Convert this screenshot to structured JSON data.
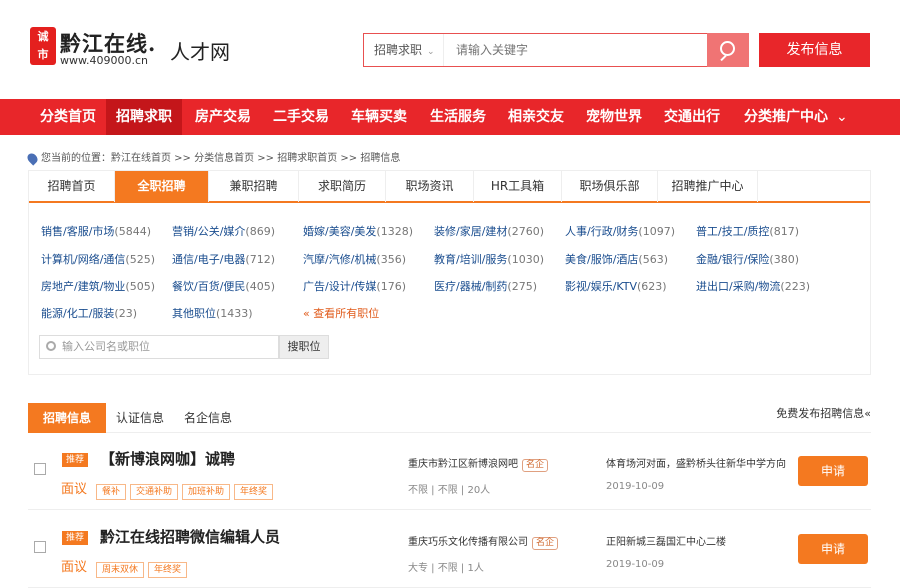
{
  "header": {
    "logo_mark": "诚\n市",
    "logo_name": "黔江在线.",
    "logo_url": "www.409000.cn",
    "logo_sub": "人才网",
    "search_type": "招聘求职",
    "search_placeholder": "请输入关键字",
    "post_button": "发布信息"
  },
  "nav": {
    "items": [
      "分类首页",
      "招聘求职",
      "房产交易",
      "二手交易",
      "车辆买卖",
      "生活服务",
      "相亲交友",
      "宠物世界",
      "交通出行",
      "分类推广中心"
    ],
    "active_index": 1,
    "more_icon": "chevron-down-icon"
  },
  "breadcrumb": "您当前的位置：黔江在线首页 >> 分类信息首页 >> 招聘求职首页 >> 招聘信息",
  "tabs": {
    "items": [
      "招聘首页",
      "全职招聘",
      "兼职招聘",
      "求职简历",
      "职场资讯",
      "HR工具箱",
      "职场俱乐部",
      "招聘推广中心"
    ],
    "active_index": 1
  },
  "categories": [
    {
      "name": "销售/客服/市场",
      "count": "(5844)"
    },
    {
      "name": "营销/公关/媒介",
      "count": "(869)"
    },
    {
      "name": "婚嫁/美容/美发",
      "count": "(1328)"
    },
    {
      "name": "装修/家居/建材",
      "count": "(2760)"
    },
    {
      "name": "人事/行政/财务",
      "count": "(1097)"
    },
    {
      "name": "普工/技工/质控",
      "count": "(817)"
    },
    {
      "name": "计算机/网络/通信",
      "count": "(525)"
    },
    {
      "name": "通信/电子/电器",
      "count": "(712)"
    },
    {
      "name": "汽摩/汽修/机械",
      "count": "(356)"
    },
    {
      "name": "教育/培训/服务",
      "count": "(1030)"
    },
    {
      "name": "美食/服饰/酒店",
      "count": "(563)"
    },
    {
      "name": "金融/银行/保险",
      "count": "(380)"
    },
    {
      "name": "房地产/建筑/物业",
      "count": "(505)"
    },
    {
      "name": "餐饮/百货/便民",
      "count": "(405)"
    },
    {
      "name": "广告/设计/传媒",
      "count": "(176)"
    },
    {
      "name": "医疗/器械/制药",
      "count": "(275)"
    },
    {
      "name": "影视/娱乐/KTV",
      "count": "(623)"
    },
    {
      "name": "进出口/采购/物流",
      "count": "(223)"
    },
    {
      "name": "能源/化工/服装",
      "count": "(23)"
    },
    {
      "name": "其他职位",
      "count": "(1433)"
    }
  ],
  "view_all": "« 查看所有职位",
  "job_search": {
    "placeholder": "输入公司名或职位",
    "button": "搜职位"
  },
  "list_tabs": {
    "items": [
      "招聘信息",
      "认证信息",
      "名企信息"
    ],
    "active_index": 0,
    "free_post": "免费发布招聘信息«"
  },
  "jobs": [
    {
      "badge": "推荐",
      "title": "【新博浪网咖】诚聘",
      "salary": "面议",
      "perks": [
        "餐补",
        "交通补助",
        "加班补助",
        "年终奖"
      ],
      "company": "重庆市黔江区新博浪网吧",
      "company_tag": "名企",
      "requirements": "不限 | 不限 | 20人",
      "address": "体育场河对面，盛黔桥头往新华中学方向",
      "date": "2019-10-09",
      "apply": "申请"
    },
    {
      "badge": "推荐",
      "title": "黔江在线招聘微信编辑人员",
      "salary": "面议",
      "perks": [
        "周末双休",
        "年终奖"
      ],
      "company": "重庆巧乐文化传播有限公司",
      "company_tag": "名企",
      "requirements": "大专 | 不限 | 1人",
      "address": "正阳新城三磊国汇中心二楼",
      "date": "2019-10-09",
      "apply": "申请"
    }
  ],
  "colors": {
    "brand_red": "#e8262a",
    "accent_orange": "#f47920",
    "link_blue": "#1a4d8f"
  }
}
